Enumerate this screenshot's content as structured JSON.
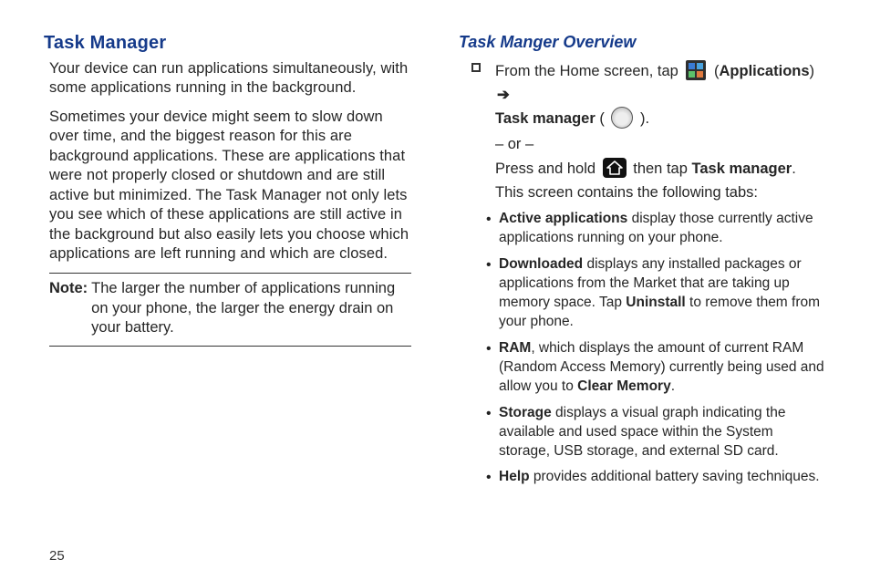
{
  "page_number": "25",
  "left": {
    "heading": "Task Manager",
    "para1": "Your device can run applications simultaneously, with some applications running in the background.",
    "para2": "Sometimes your device might seem to slow down over time, and the biggest reason for this are background applications. These are applications that were not properly closed or shutdown and are still active but minimized. The Task Manager not only lets you see which of these applications are still active in the background but also easily lets you choose which applications are left running and which are closed.",
    "note_label": "Note:",
    "note_text": "The larger the number of applications running on your phone, the larger the energy drain on your battery."
  },
  "right": {
    "heading": "Task Manger Overview",
    "step_prefix": "From the Home screen, tap ",
    "applications_label": "Applications",
    "task_manager_label": "Task manager",
    "or_text": "– or –",
    "press_hold_pre": "Press and hold ",
    "press_hold_mid": " then tap ",
    "task_manager_bold": "Task manager",
    "press_hold_post": ". This screen contains the following tabs:",
    "items": {
      "active_label": "Active applications",
      "active_rest": " display those currently active applications running on your phone.",
      "downloaded_label": "Downloaded",
      "downloaded_rest_a": " displays any installed packages or applications from the Market that are taking up memory space. Tap ",
      "uninstall_label": "Uninstall",
      "downloaded_rest_b": " to remove them from your phone.",
      "ram_label": "RAM",
      "ram_rest_a": ", which displays the amount of current RAM (Random Access Memory) currently being used and allow you to ",
      "clear_memory_label": "Clear Memory",
      "ram_rest_b": ".",
      "storage_label": "Storage",
      "storage_rest": " displays a visual graph indicating the available and used space within the System storage, USB storage, and external SD card.",
      "help_label": "Help",
      "help_rest": " provides additional battery saving techniques."
    }
  }
}
